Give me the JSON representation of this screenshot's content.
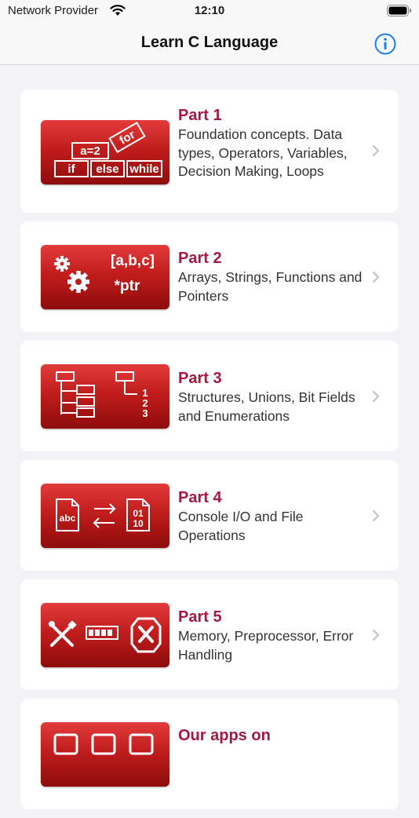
{
  "status": {
    "carrier": "Network Provider",
    "time": "12:10"
  },
  "nav": {
    "title": "Learn C Language",
    "info_icon": "info-circle-icon"
  },
  "accent_colors": {
    "title": "#a6183f",
    "nav_button": "#1a7cf6",
    "icon_red": "#c21d1d"
  },
  "parts": [
    {
      "title": "Part 1",
      "desc": "Foundation concepts. Data types, Operators, Variables, Decision Making, Loops",
      "icon": "keywords-icon",
      "icon_labels": [
        "a=2",
        "for",
        "if",
        "else",
        "while"
      ]
    },
    {
      "title": "Part 2",
      "desc": "Arrays, Strings, Functions and Pointers",
      "icon": "gears-pointer-icon",
      "icon_labels": [
        "[a,b,c]",
        "*ptr"
      ]
    },
    {
      "title": "Part 3",
      "desc": "Structures, Unions, Bit Fields and Enumerations",
      "icon": "tree-structure-icon",
      "icon_labels": [
        "1",
        "2",
        "3"
      ]
    },
    {
      "title": "Part 4",
      "desc": "Console I/O and File Operations",
      "icon": "file-io-icon",
      "icon_labels": [
        "abc",
        "01",
        "10"
      ]
    },
    {
      "title": "Part 5",
      "desc": "Memory, Preprocessor, Error Handling",
      "icon": "tools-memory-error-icon",
      "icon_labels": []
    },
    {
      "title": "Our apps on",
      "desc": "",
      "icon": "apps-grid-icon",
      "icon_labels": []
    }
  ]
}
